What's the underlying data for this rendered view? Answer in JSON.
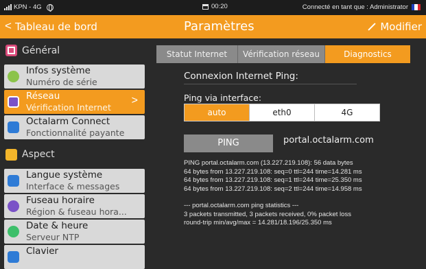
{
  "statusbar": {
    "carrier": "KPN - 4G",
    "time": "00:20",
    "connected_text": "Connecté en tant que : Administrator"
  },
  "header": {
    "back_label": "Tableau de bord",
    "title": "Paramètres",
    "modify_label": "Modifier"
  },
  "sidebar": {
    "sections": [
      {
        "label": "Général",
        "icon": "general-icon",
        "color": "#d94a7a"
      },
      {
        "label": "Aspect",
        "icon": "aspect-icon",
        "color": "#f3b52a"
      }
    ],
    "items": [
      {
        "title": "Infos système",
        "subtitle": "Numéro de série",
        "icon": "info-icon",
        "color": "#8bc34a"
      },
      {
        "title": "Réseau",
        "subtitle": "Vérification Internet",
        "icon": "network-icon",
        "color": "#7a52c7"
      },
      {
        "title": "Octalarm Connect",
        "subtitle": "Fonctionnalité payante",
        "icon": "connect-icon",
        "color": "#2e7bd6"
      },
      {
        "title": "Langue système",
        "subtitle": "Interface & messages",
        "icon": "language-icon",
        "color": "#2e7bd6"
      },
      {
        "title": "Fuseau horaire",
        "subtitle": "Région & fuseau hora...",
        "icon": "timezone-icon",
        "color": "#7a52c7"
      },
      {
        "title": "Date & heure",
        "subtitle": "Serveur NTP",
        "icon": "clock-icon",
        "color": "#3dbf6a"
      },
      {
        "title": "Clavier",
        "subtitle": "",
        "icon": "keyboard-icon",
        "color": "#2e7bd6"
      }
    ]
  },
  "content": {
    "tabs": [
      "Statut Internet",
      "Vérification réseau",
      "Diagnostics"
    ],
    "section_title": "Connexion Internet Ping:",
    "ping_via_label": "Ping via interface:",
    "interfaces": [
      "auto",
      "eth0",
      "4G"
    ],
    "selected_interface": "auto",
    "ping_button": "PING",
    "host": "portal.octalarm.com",
    "output_lines": [
      "PING portal.octalarm.com (13.227.219.108): 56 data bytes",
      "64 bytes from 13.227.219.108: seq=0 ttl=244 time=14.281 ms",
      "64 bytes from 13.227.219.108: seq=1 ttl=244 time=25.350 ms",
      "64 bytes from 13.227.219.108: seq=2 ttl=244 time=14.958 ms",
      "",
      "--- portal.octalarm.com ping statistics ---",
      "3 packets transmitted, 3 packets received, 0% packet loss",
      "round-trip min/avg/max = 14.281/18.196/25.350 ms"
    ]
  },
  "colors": {
    "accent": "#f39b1f",
    "background": "#2a2a2a",
    "item_bg": "#d9d9d9",
    "tab_inactive": "#8a8a8a"
  }
}
